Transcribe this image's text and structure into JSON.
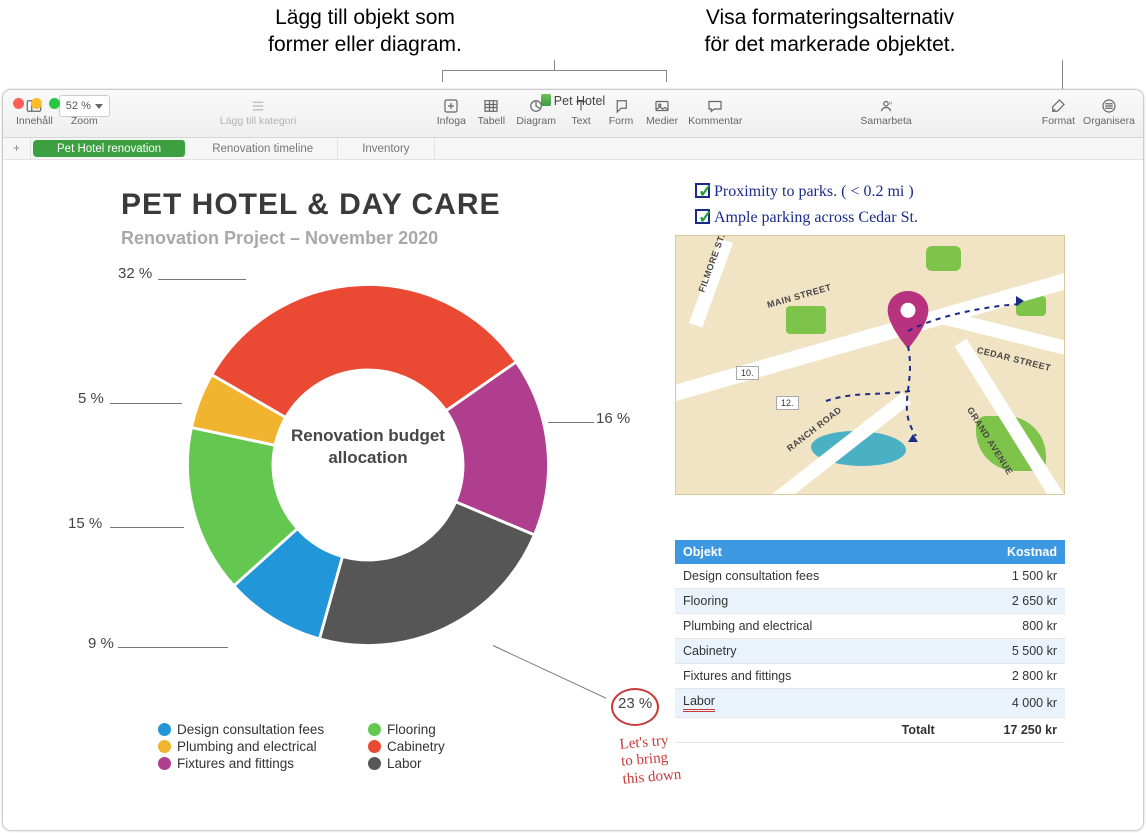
{
  "callouts": {
    "left": "Lägg till objekt som\nformer eller diagram.",
    "right": "Visa formateringsalternativ\nför det markerade objektet."
  },
  "window": {
    "doc_title": "Pet Hotel",
    "zoom_value": "52 %",
    "toolbar": {
      "innehall": "Innehåll",
      "zoom": "Zoom",
      "lagg_till_kategori": "Lägg till kategori",
      "infoga": "Infoga",
      "tabell": "Tabell",
      "diagram": "Diagram",
      "text": "Text",
      "form": "Form",
      "medier": "Medier",
      "kommentar": "Kommentar",
      "samarbeta": "Samarbeta",
      "format": "Format",
      "organisera": "Organisera"
    },
    "sheets": {
      "add_tooltip": "+",
      "tabs": [
        "Pet Hotel renovation",
        "Renovation timeline",
        "Inventory"
      ]
    }
  },
  "page": {
    "title": "PET HOTEL & DAY CARE",
    "subtitle": "Renovation Project – November 2020"
  },
  "handwriting": {
    "line1": "Proximity to parks. ( < 0.2 mi )",
    "line2": "Ample parking across  Cedar St."
  },
  "chart_data": {
    "type": "pie",
    "title": "Renovation budget allocation",
    "series": [
      {
        "name": "Design consultation fees",
        "value": 9,
        "color": "#2196d8",
        "label": "9 %"
      },
      {
        "name": "Flooring",
        "value": 15,
        "color": "#64c850",
        "label": "15 %"
      },
      {
        "name": "Plumbing and electrical",
        "value": 5,
        "color": "#f0b42e",
        "label": "5 %"
      },
      {
        "name": "Cabinetry",
        "value": 32,
        "color": "#ea4a33",
        "label": "32 %"
      },
      {
        "name": "Fixtures and fittings",
        "value": 16,
        "color": "#b03e8e",
        "label": "16 %"
      },
      {
        "name": "Labor",
        "value": 23,
        "color": "#565656",
        "label": "23 %"
      }
    ],
    "legend_order": [
      [
        "Design consultation fees",
        "Flooring"
      ],
      [
        "Plumbing and electrical",
        "Cabinetry"
      ],
      [
        "Fixtures and fittings",
        "Labor"
      ]
    ]
  },
  "annotation": {
    "text": "Let's try\nto bring\nthis down"
  },
  "map": {
    "roads": [
      "FILMORE ST.",
      "MAIN STREET",
      "CEDAR STREET",
      "RANCH ROAD",
      "GRAND AVENUE"
    ],
    "badges": [
      "10.",
      "12."
    ]
  },
  "cost_table": {
    "headers": {
      "item": "Objekt",
      "cost": "Kostnad"
    },
    "rows": [
      {
        "item": "Design consultation fees",
        "cost": "1 500 kr"
      },
      {
        "item": "Flooring",
        "cost": "2 650 kr"
      },
      {
        "item": "Plumbing and electrical",
        "cost": "800 kr"
      },
      {
        "item": "Cabinetry",
        "cost": "5 500 kr"
      },
      {
        "item": "Fixtures and fittings",
        "cost": "2 800 kr"
      },
      {
        "item": "Labor",
        "cost": "4 000 kr"
      }
    ],
    "total_label": "Totalt",
    "total_value": "17 250 kr"
  }
}
